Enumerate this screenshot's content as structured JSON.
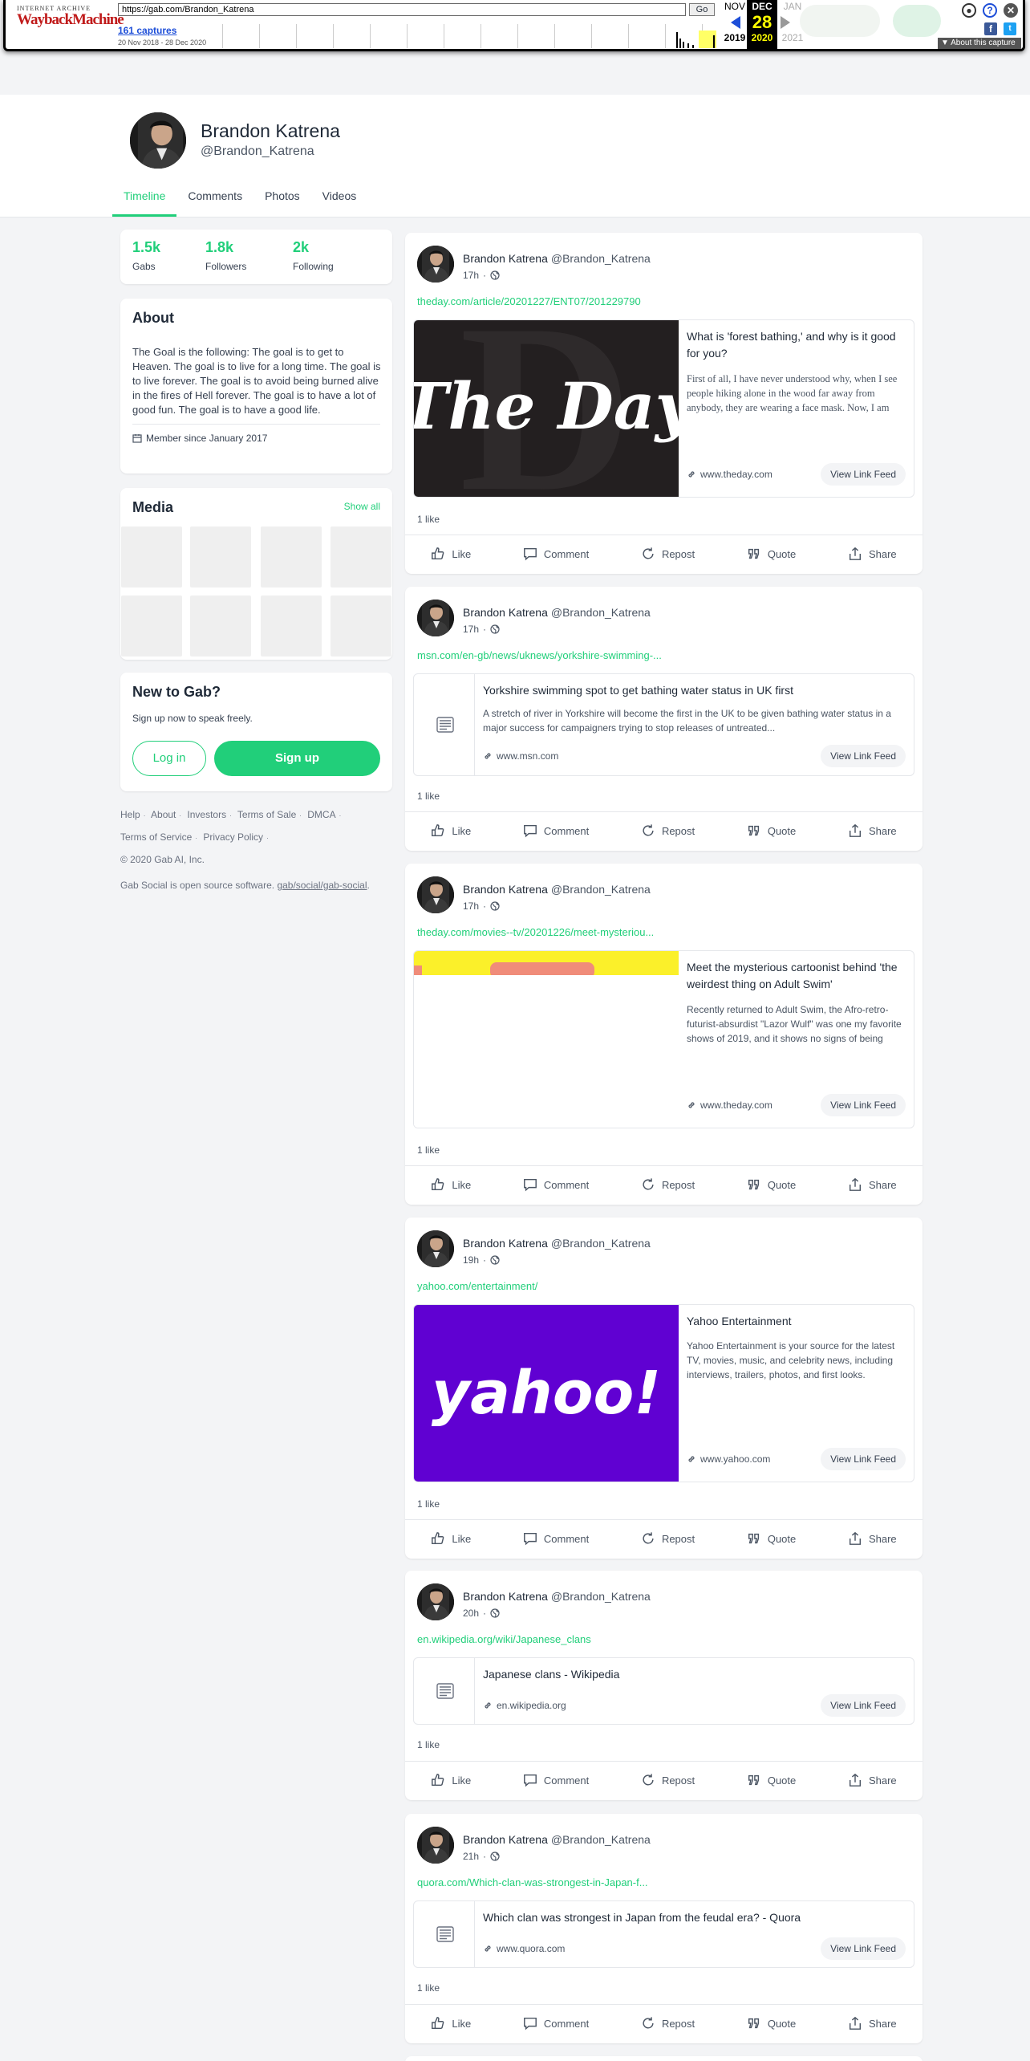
{
  "wayback": {
    "logo_top": "INTERNET ARCHIVE",
    "logo_main": "WaybackMachine",
    "url": "https://gab.com/Brandon_Katrena",
    "go_label": "Go",
    "captures": "161 captures",
    "range": "20 Nov 2018 - 28 Dec 2020",
    "prev": {
      "month": "NOV",
      "year": "2019"
    },
    "current": {
      "month": "DEC",
      "day": "28",
      "year": "2020"
    },
    "next": {
      "month": "JAN",
      "year": "2021"
    },
    "about": "▼ About this capture",
    "icons": [
      "account-icon",
      "help-icon",
      "close-icon",
      "facebook-icon",
      "twitter-icon"
    ]
  },
  "profile": {
    "name": "Brandon Katrena",
    "handle": "@Brandon_Katrena",
    "tabs": [
      "Timeline",
      "Comments",
      "Photos",
      "Videos"
    ],
    "active_tab": "Timeline"
  },
  "stats": [
    {
      "value": "1.5k",
      "label": "Gabs"
    },
    {
      "value": "1.8k",
      "label": "Followers"
    },
    {
      "value": "2k",
      "label": "Following"
    }
  ],
  "about": {
    "title": "About",
    "text": "The Goal is the following: The goal is to get to Heaven. The goal is to live for a long time. The goal is to live forever. The goal is to avoid being burned alive in the fires of Hell forever. The goal is to have a lot of good fun. The goal is to have a good life.",
    "member_since": "Member since January 2017"
  },
  "media": {
    "title": "Media",
    "show_all": "Show all"
  },
  "new_to_gab": {
    "title": "New to Gab?",
    "subtitle": "Sign up now to speak freely.",
    "login": "Log in",
    "signup": "Sign up"
  },
  "footer": {
    "links": [
      "Help",
      "About",
      "Investors",
      "Terms of Sale",
      "DMCA",
      "Terms of Service",
      "Privacy Policy"
    ],
    "copyright": "© 2020 Gab AI, Inc.",
    "oss_text": "Gab Social is open source software.",
    "oss_link": "gab/social/gab-social"
  },
  "actions": [
    "Like",
    "Comment",
    "Repost",
    "Quote",
    "Share"
  ],
  "view_link_feed": "View Link Feed",
  "colors": {
    "accent": "#21cf7a",
    "yahoo_purple": "#6001d2",
    "theday_dark": "#231f20"
  },
  "posts": [
    {
      "author": "Brandon Katrena",
      "handle": "@Brandon_Katrena",
      "time": "17h",
      "link": "theday.com/article/20201227/ENT07/201229790",
      "card_title": "What is 'forest bathing,' and why is it good for you?",
      "card_desc": "First of all, I have never understood why, when I see people hiking alone in the wood far away from anybody, they are wearing a face mask. Now, I am",
      "card_domain": "www.theday.com",
      "image_text": "The Day",
      "likes": "1 like"
    },
    {
      "author": "Brandon Katrena",
      "handle": "@Brandon_Katrena",
      "time": "17h",
      "link": "msn.com/en-gb/news/uknews/yorkshire-swimming-...",
      "card_title": "Yorkshire swimming spot to get bathing water status in UK first",
      "card_desc": "A stretch of river in Yorkshire will become the first in the UK to be given bathing water status in a major success for campaigners trying to stop releases of untreated...",
      "card_domain": "www.msn.com",
      "likes": "1 like"
    },
    {
      "author": "Brandon Katrena",
      "handle": "@Brandon_Katrena",
      "time": "17h",
      "link": "theday.com/movies--tv/20201226/meet-mysteriou...",
      "card_title": "Meet the mysterious cartoonist behind 'the weirdest thing on Adult Swim'",
      "card_desc": "Recently returned to Adult Swim, the Afro-retro-futurist-absurdist \"Lazor Wulf\" was one my favorite shows of 2019, and it shows no signs of being",
      "card_domain": "www.theday.com",
      "likes": "1 like"
    },
    {
      "author": "Brandon Katrena",
      "handle": "@Brandon_Katrena",
      "time": "19h",
      "link": "yahoo.com/entertainment/",
      "card_title": "Yahoo Entertainment",
      "card_desc": "Yahoo Entertainment is your source for the latest TV, movies,  music, and celebrity news, including interviews, trailers, photos, and first looks.",
      "card_domain": "www.yahoo.com",
      "image_text": "yahoo!",
      "likes": "1 like"
    },
    {
      "author": "Brandon Katrena",
      "handle": "@Brandon_Katrena",
      "time": "20h",
      "link": "en.wikipedia.org/wiki/Japanese_clans",
      "card_title": "Japanese clans - Wikipedia",
      "card_domain": "en.wikipedia.org",
      "likes": "1 like"
    },
    {
      "author": "Brandon Katrena",
      "handle": "@Brandon_Katrena",
      "time": "21h",
      "link": "quora.com/Which-clan-was-strongest-in-Japan-f...",
      "card_title": "Which clan was strongest in Japan from the feudal era? - Quora",
      "card_domain": "www.quora.com",
      "likes": "1 like"
    }
  ]
}
